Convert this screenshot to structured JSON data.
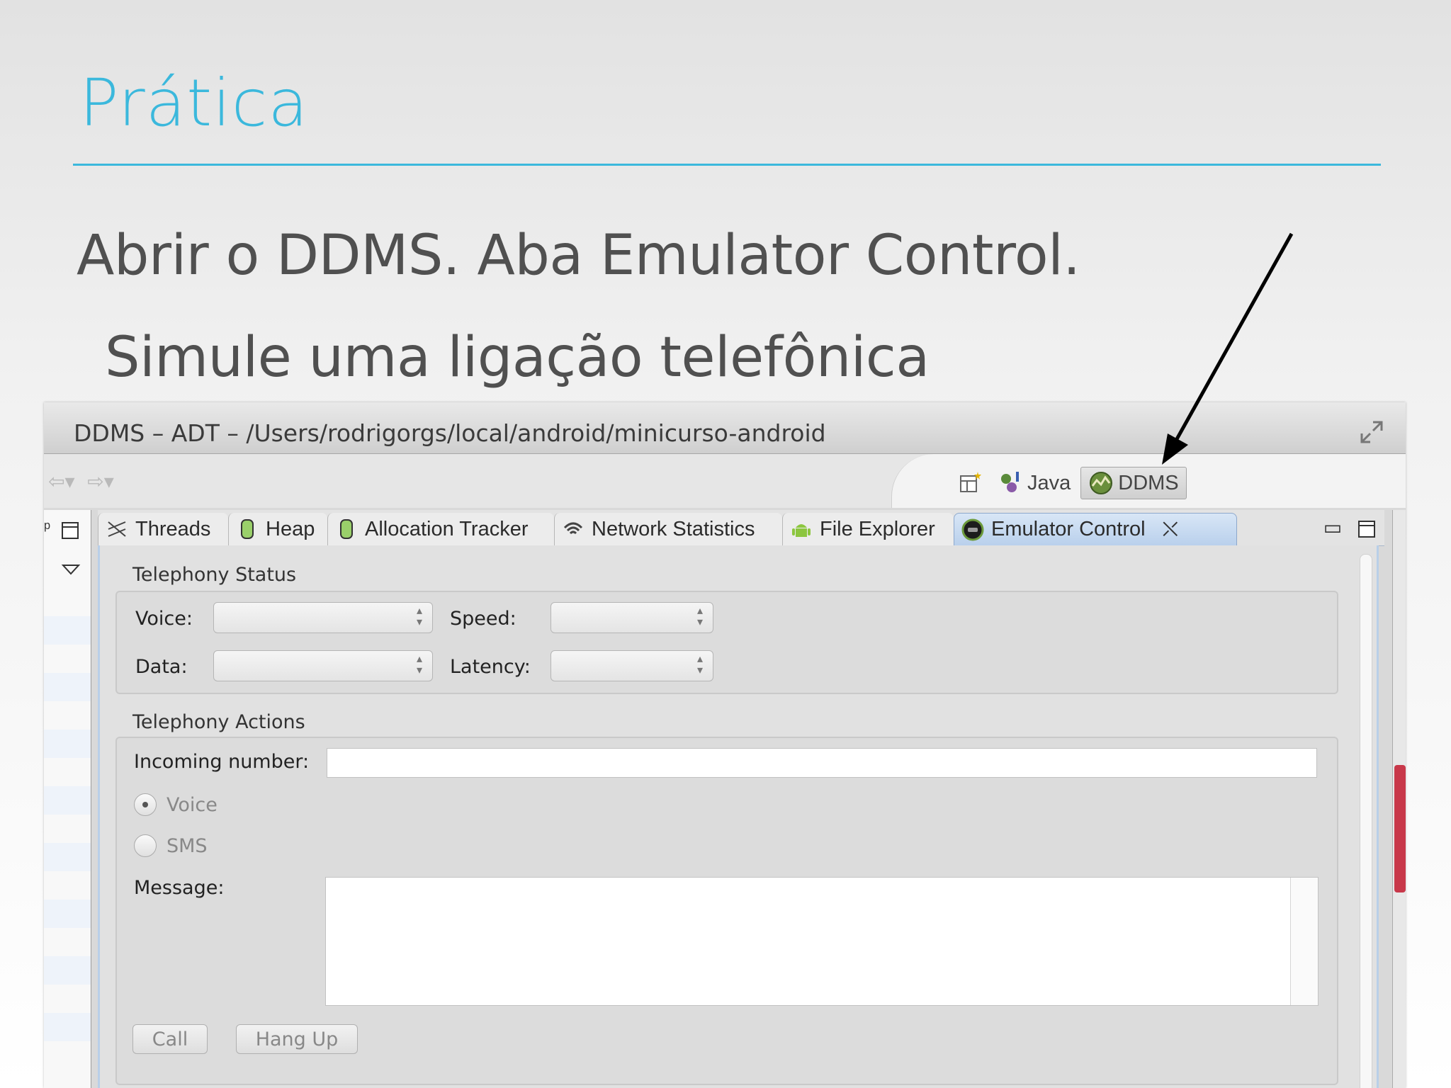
{
  "slide": {
    "title": "Prática",
    "bullet1": "Abrir o DDMS. Aba Emulator Control.",
    "bullet2": "Simule uma ligação telefônica"
  },
  "window": {
    "title": "DDMS – ADT – /Users/rodrigorgs/local/android/minicurso-android"
  },
  "perspectives": {
    "java_label": "Java",
    "ddms_label": "DDMS"
  },
  "tabs": [
    {
      "label": "Threads",
      "icon": "threads-icon"
    },
    {
      "label": "Heap",
      "icon": "heap-icon"
    },
    {
      "label": "Allocation Tracker",
      "icon": "allocation-icon"
    },
    {
      "label": "Network Statistics",
      "icon": "wifi-icon"
    },
    {
      "label": "File Explorer",
      "icon": "android-icon"
    },
    {
      "label": "Emulator Control",
      "icon": "emulator-icon",
      "active": true
    }
  ],
  "telephony_status": {
    "group_label": "Telephony Status",
    "voice_label": "Voice:",
    "speed_label": "Speed:",
    "data_label": "Data:",
    "latency_label": "Latency:",
    "voice_value": "",
    "speed_value": "",
    "data_value": "",
    "latency_value": ""
  },
  "telephony_actions": {
    "group_label": "Telephony Actions",
    "incoming_label": "Incoming number:",
    "incoming_value": "",
    "voice_radio": "Voice",
    "sms_radio": "SMS",
    "selected": "Voice",
    "message_label": "Message:",
    "message_value": "",
    "call_button": "Call",
    "hangup_button": "Hang Up"
  },
  "colors": {
    "accent": "#3bb8dc",
    "text": "#505050",
    "active_tab": "#b9d0ec"
  }
}
